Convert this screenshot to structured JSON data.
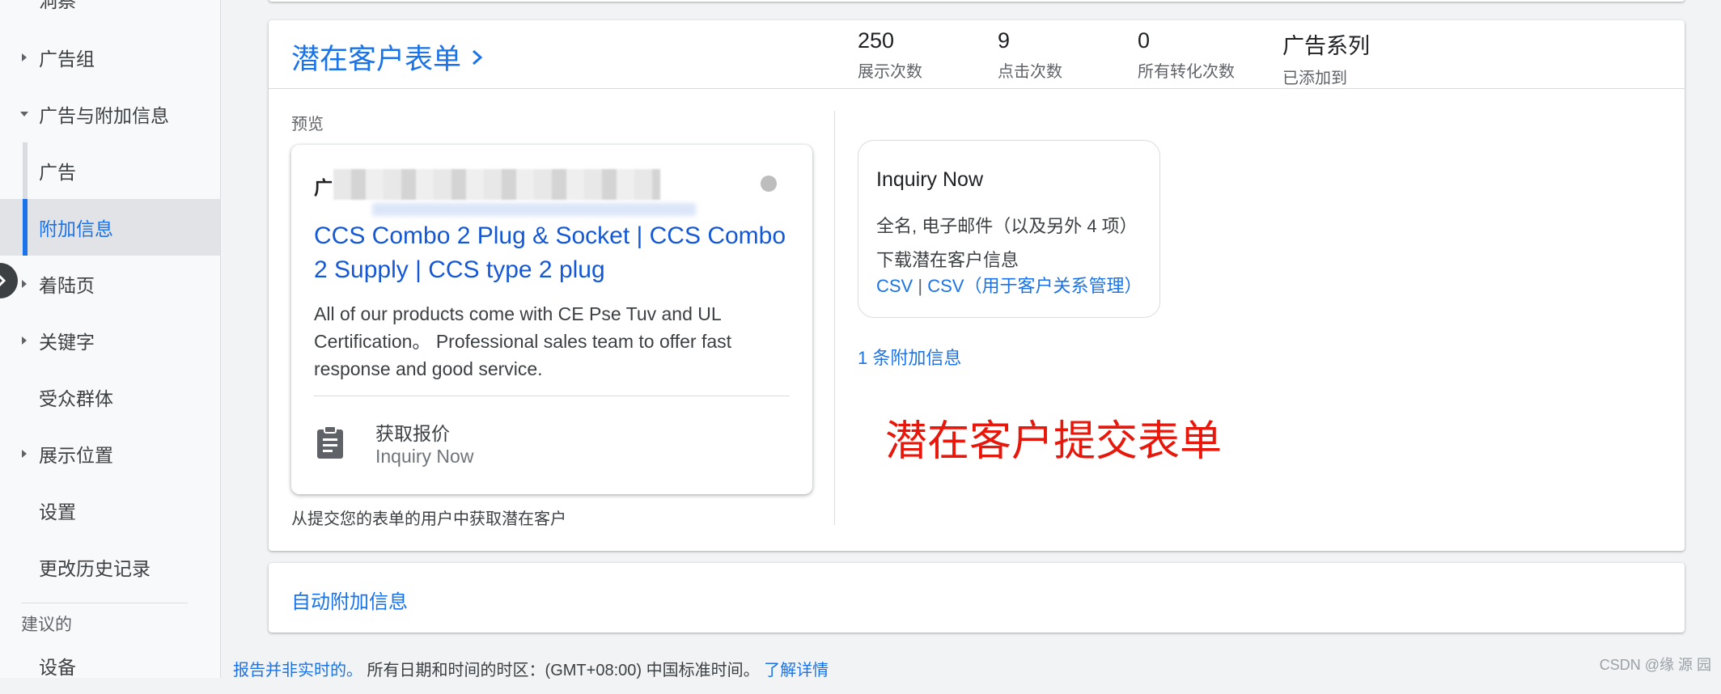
{
  "sidebar": {
    "items": [
      {
        "label": "洞察",
        "caret": "none"
      },
      {
        "label": "广告组",
        "caret": "right"
      },
      {
        "label": "广告与附加信息",
        "caret": "down"
      },
      {
        "label": "广告",
        "caret": "none"
      },
      {
        "label": "附加信息",
        "caret": "none",
        "active": true
      },
      {
        "label": "着陆页",
        "caret": "right"
      },
      {
        "label": "关键字",
        "caret": "right"
      },
      {
        "label": "受众群体",
        "caret": "none"
      },
      {
        "label": "展示位置",
        "caret": "right"
      },
      {
        "label": "设置",
        "caret": "none"
      },
      {
        "label": "更改历史记录",
        "caret": "none"
      },
      {
        "label": "设备",
        "caret": "none"
      }
    ],
    "section_label": "建议的"
  },
  "main_card": {
    "title": "潜在客户表单",
    "stats": [
      {
        "value": "250",
        "label": "展示次数"
      },
      {
        "value": "9",
        "label": "点击次数"
      },
      {
        "value": "0",
        "label": "所有转化次数"
      },
      {
        "value": "广告系列",
        "label": "已添加到"
      }
    ],
    "preview_label": "预览",
    "ad": {
      "badge": "广",
      "headline": "CCS Combo 2 Plug & Socket | CCS Combo 2 Supply | CCS type 2 plug",
      "description": "All of our products come with CE Pse Tuv and UL Certification。 Professional sales team to offer fast response and good service.",
      "cta_title": "获取报价",
      "cta_subtitle": "Inquiry Now",
      "icon": "clipboard-icon"
    },
    "preview_caption": "从提交您的表单的用户中获取潜在客户",
    "form_info": {
      "title": "Inquiry Now",
      "fields": "全名, 电子邮件（以及另外 4 项）",
      "download_label": "下载潜在客户信息",
      "link_csv": "CSV",
      "separator": "|",
      "link_csv_crm": "CSV（用于客户关系管理）"
    },
    "extension_count_link": "1 条附加信息",
    "annotation": "潜在客户提交表单"
  },
  "auto_card": {
    "label": "自动附加信息"
  },
  "footer": {
    "part1": "报告并非实时的。",
    "part2": " 所有日期和时间的时区：(GMT+08:00) 中国标准时间。",
    "link": "了解详情"
  },
  "watermark": "CSDN @缘 源 园",
  "colors": {
    "accent": "#1a73e8",
    "annotation": "#e8170b"
  }
}
